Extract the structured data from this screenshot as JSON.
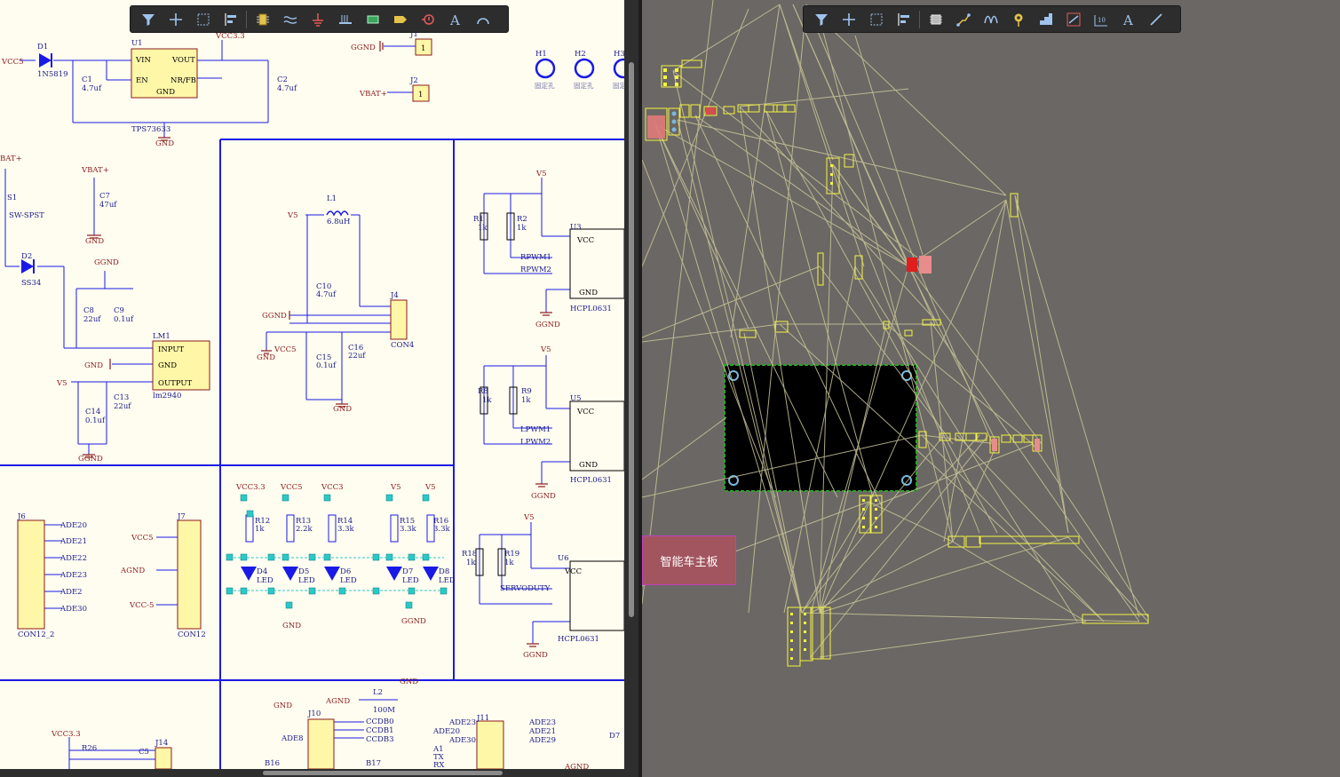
{
  "schematic": {
    "power": {
      "vcc33_top": "VCC3.3",
      "vcc5": "VCC5",
      "vbat": "VBAT+",
      "vbat_left": "BAT+",
      "ggnd": "GGND",
      "gnd": "GND",
      "v5": "V5",
      "agnd": "AGND",
      "vcc5_neg": "VCC-5"
    },
    "components": {
      "d1": "D1",
      "d1_part": "1N5819",
      "u1": "U1",
      "u1_part": "TPS73633",
      "u1_vin": "VIN",
      "u1_vout": "VOUT",
      "u1_en": "EN",
      "u1_nrfb": "NR/FB",
      "u1_gnd": "GND",
      "c1": "C1",
      "c1_val": "4.7uf",
      "c2": "C2",
      "c2_val": "4.7uf",
      "j1": "J1",
      "j2": "J2",
      "j1_pin": "1",
      "j2_pin": "1",
      "h1": "H1",
      "h2": "H2",
      "h3": "H3",
      "h_label": "固定孔",
      "s1": "S1",
      "s1_part": "SW-SPST",
      "c7": "C7",
      "c7_val": "47uf",
      "d2": "D2",
      "d2_part": "SS34",
      "c8": "C8",
      "c8_val": "22uf",
      "c9": "C9",
      "c9_val": "0.1uf",
      "lm1": "LM1",
      "lm1_part": "lm2940",
      "lm1_in": "INPUT",
      "lm1_gnd": "GND",
      "lm1_out": "OUTPUT",
      "c13": "C13",
      "c13_val": "22uf",
      "c14": "C14",
      "c14_val": "0.1uf",
      "l1": "L1",
      "l1_val": "6.8uH",
      "c10": "C10",
      "c10_val": "4.7uf",
      "c15": "C15",
      "c15_val": "0.1uf",
      "c16": "C16",
      "c16_val": "22uf",
      "j4": "J4",
      "j4_part": "CON4",
      "r1": "R1",
      "r1_val": "1k",
      "r2": "R2",
      "r2_val": "1k",
      "u3": "U3",
      "u3_part": "HCPL0631",
      "rpwm1": "RPWM1",
      "rpwm2": "RPWM2",
      "r8": "R8",
      "r8_val": "1k",
      "r9": "R9",
      "r9_val": "1k",
      "u5": "U5",
      "u5_part": "HCPL0631",
      "lpwm1": "LPWM1",
      "lpwm2": "LPWM2",
      "r18": "R18",
      "r18_val": "1k",
      "r19": "R19",
      "r19_val": "1k",
      "u6": "U6",
      "u6_part": "HCPL0631",
      "servoduty": "SERVODUTY",
      "opto_vcc": "VCC",
      "opto_gnd": "GND",
      "j6": "J6",
      "j6_part": "CON12_2",
      "j7": "J7",
      "j7_part": "CON12",
      "ade": [
        "ADE20",
        "ADE21",
        "ADE22",
        "ADE23",
        "ADE2",
        "ADE30"
      ],
      "r12": "R12",
      "r12_val": "1k",
      "r13": "R13",
      "r13_val": "2.2k",
      "r14": "R14",
      "r14_val": "3.3k",
      "r15": "R15",
      "r15_val": "3.3k",
      "r16": "R16",
      "r16_val": "3.3k",
      "d4": "D4",
      "d5": "D5",
      "d6": "D6",
      "d7": "D7",
      "d8": "D8",
      "led": "LED",
      "vcc33_led": "VCC3.3",
      "vcc5_led": "VCC5",
      "vcc3_led": "VCC3",
      "v5_led1": "V5",
      "v5_led2": "V5",
      "l2": "L2",
      "l2_val": "100M",
      "j10": "J10",
      "j11": "J11",
      "j14": "J14",
      "ccd": [
        "CCDB0",
        "CCDB1",
        "CCDB3"
      ],
      "ade_j10": "ADE8",
      "b16": "B16",
      "b17": "B17",
      "ade_j11l": [
        "ADE23",
        "ADE20",
        "ADE30"
      ],
      "ade_j11r": [
        "ADE23",
        "ADE21",
        "ADE29"
      ],
      "a1": "A1",
      "tx": "TX",
      "rx": "RX",
      "r26": "R26",
      "c5": "C5",
      "d7b": "D7"
    }
  },
  "pcb": {
    "board_label": "智能车主板",
    "colors": {
      "bg": "#6b6764",
      "ratsnest": "#c9c69a",
      "silk": "#f5f542",
      "board": "#000000"
    }
  },
  "toolbars": {
    "schematic": [
      "filter-icon",
      "add-icon",
      "select-rect-icon",
      "align-icon",
      "component-icon",
      "wire-icon",
      "power-port-icon",
      "bus-icon",
      "sheet-symbol-icon",
      "port-icon",
      "directive-icon",
      "text-icon",
      "arc-icon"
    ],
    "pcb": [
      "filter-icon",
      "add-icon",
      "select-rect-icon",
      "align-icon",
      "component-icon",
      "route-icon",
      "interactive-route-icon",
      "via-icon",
      "polygon-icon",
      "differential-icon",
      "dimension-icon",
      "text-icon",
      "line-icon"
    ]
  }
}
